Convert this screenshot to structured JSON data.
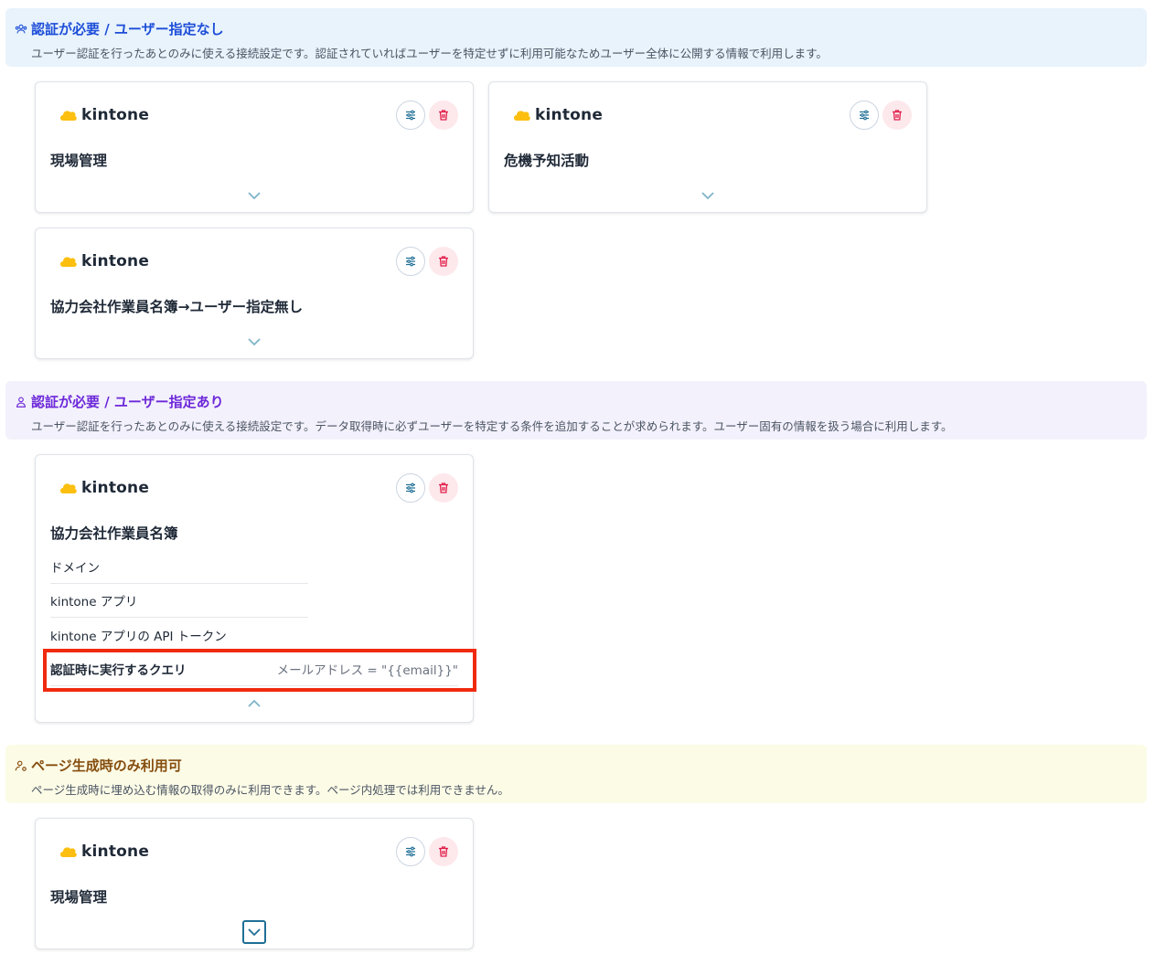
{
  "sections": [
    {
      "title": "認証が必要 / ユーザー指定なし",
      "description": "ユーザー認証を行ったあとのみに使える接続設定です。認証されていればユーザーを特定せずに利用可能なためユーザー全体に公開する情報で利用します。",
      "color": "#1d4ed8",
      "background": "#e8f3fc",
      "icon": "users-icon"
    },
    {
      "title": "認証が必要 / ユーザー指定あり",
      "description": "ユーザー認証を行ったあとのみに使える接続設定です。データ取得時に必ずユーザーを特定する条件を追加することが求められます。ユーザー固有の情報を扱う場合に利用します。",
      "color": "#6d28d9",
      "background": "#f3f1fc",
      "icon": "user-icon"
    },
    {
      "title": "ページ生成時のみ利用可",
      "description": "ページ生成時に埋め込む情報の取得のみに利用できます。ページ内処理では利用できません。",
      "color": "#854d0e",
      "background": "#fcfbe6",
      "icon": "user-settings-icon"
    }
  ],
  "brand": "kintone",
  "brand_color": "#fcbf10",
  "cards": {
    "c1": {
      "name": "現場管理"
    },
    "c2": {
      "name": "危機予知活動"
    },
    "c3": {
      "name": "協力会社作業員名簿→ユーザー指定無し"
    },
    "c4": {
      "name": "協力会社作業員名簿",
      "fields": [
        "ドメイン",
        "kintone アプリ",
        "kintone アプリの API トークン"
      ],
      "query_label": "認証時に実行するクエリ",
      "query_value": "メールアドレス = \"{{email}}\""
    },
    "c5": {
      "name": "現場管理"
    }
  },
  "icons": {
    "settings": "sliders-icon",
    "delete": "trash-icon",
    "expand": "chevron-down-icon",
    "collapse": "chevron-up-icon"
  },
  "colors": {
    "delete_icon": "#e11d48",
    "delete_bg": "#fde8ec",
    "settings_icon": "#1f6f96",
    "chevron": "#7fb3c9",
    "highlight_border": "#f02a0f"
  }
}
